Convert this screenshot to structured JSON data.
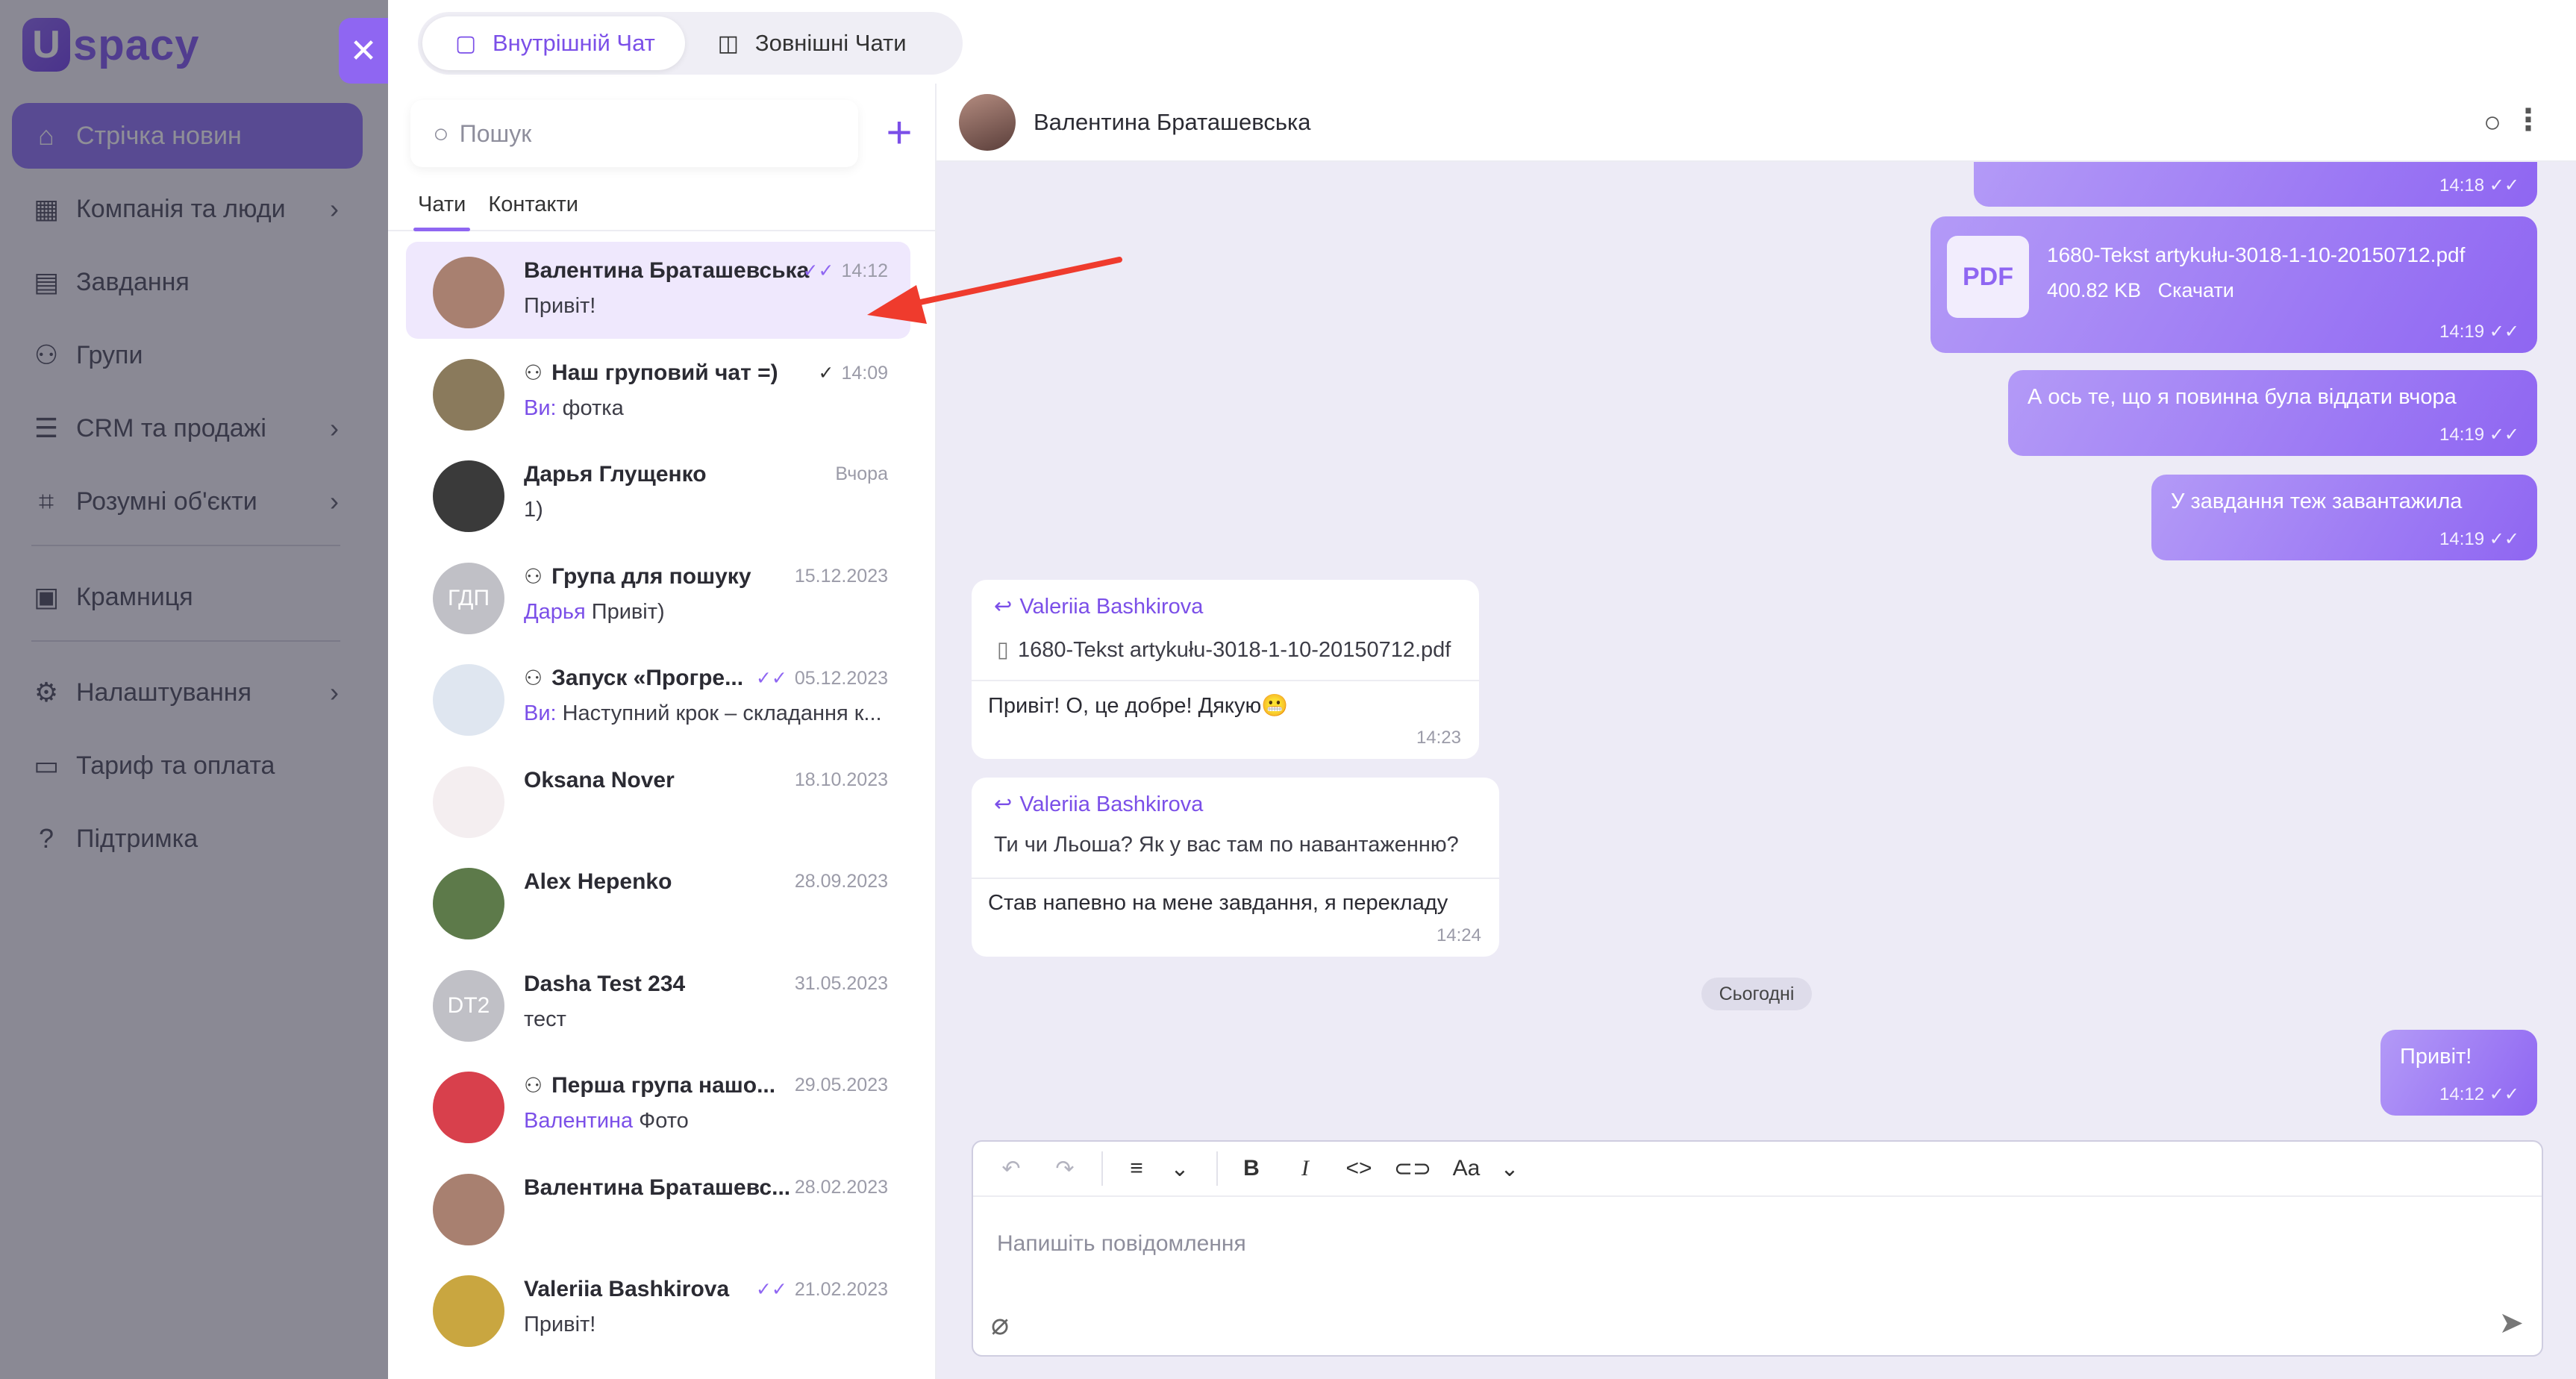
{
  "app": {
    "logo_letter": "U",
    "logo_text": "spacy",
    "close_label": "✕"
  },
  "nav": {
    "items": [
      {
        "label": "Стрічка новин",
        "icon": "home-icon",
        "glyph": "⌂"
      },
      {
        "label": "Компанія та люди",
        "icon": "building-icon",
        "glyph": "▦"
      },
      {
        "label": "Завдання",
        "icon": "calendar-icon",
        "glyph": "▤"
      },
      {
        "label": "Групи",
        "icon": "people-icon",
        "glyph": "⚇"
      },
      {
        "label": "CRM та продажі",
        "icon": "database-icon",
        "glyph": "☰"
      },
      {
        "label": "Розумні об'єкти",
        "icon": "scan-icon",
        "glyph": "⌗"
      },
      {
        "label": "Крамниця",
        "icon": "store-icon",
        "glyph": "▣"
      },
      {
        "label": "Налаштування",
        "icon": "gear-icon",
        "glyph": "⚙"
      },
      {
        "label": "Тариф та оплата",
        "icon": "wallet-icon",
        "glyph": "▭"
      },
      {
        "label": "Підтримка",
        "icon": "help-icon",
        "glyph": "?"
      }
    ],
    "chevron": "›"
  },
  "top_tabs": [
    {
      "label": "Внутрішній Чат",
      "icon": "chat-icon",
      "glyph": "▢"
    },
    {
      "label": "Зовнішні Чати",
      "icon": "chats-icon",
      "glyph": "◫"
    }
  ],
  "chat_panel": {
    "search_placeholder": "Пошук",
    "add_label": "+",
    "tabs": [
      "Чати",
      "Контакти"
    ]
  },
  "chats": [
    {
      "name": "Валентина Браташевська",
      "group": false,
      "time": "14:12",
      "tick": "✓✓",
      "sender": "",
      "message": "Привіт!",
      "avatar_text": "",
      "avatar_bg": "#a88070"
    },
    {
      "name": "Наш груповий чат =)",
      "group": true,
      "time": "14:09",
      "tick": "✓",
      "sender": "Ви:",
      "message": "фотка",
      "avatar_text": "",
      "avatar_bg": "#8a7a5c"
    },
    {
      "name": "Дарья Глущенко",
      "group": false,
      "time": "Вчора",
      "tick": "",
      "sender": "",
      "message": "1)",
      "avatar_text": "",
      "avatar_bg": "#3a3a3a"
    },
    {
      "name": "Група для пошуку",
      "group": true,
      "time": "15.12.2023",
      "tick": "",
      "sender": "Дарья",
      "message": "Привіт)",
      "avatar_text": "ГДП",
      "avatar_bg": "#c0c0c6"
    },
    {
      "name": "Запуск «Прогре...",
      "group": true,
      "time": "05.12.2023",
      "tick": "✓✓",
      "sender": "Ви:",
      "message": "Наступний крок – складання к...",
      "avatar_text": "",
      "avatar_bg": "#dfe6f0"
    },
    {
      "name": "Oksana Nover",
      "group": false,
      "time": "18.10.2023",
      "tick": "",
      "sender": "",
      "message": "",
      "avatar_text": "",
      "avatar_bg": "#f4eef0"
    },
    {
      "name": "Alex Hepenko",
      "group": false,
      "time": "28.09.2023",
      "tick": "",
      "sender": "",
      "message": "",
      "avatar_text": "",
      "avatar_bg": "#5d7a4a"
    },
    {
      "name": "Dasha Test 234",
      "group": false,
      "time": "31.05.2023",
      "tick": "",
      "sender": "",
      "message": "тест",
      "avatar_text": "DT2",
      "avatar_bg": "#c0c0c6"
    },
    {
      "name": "Перша група нашо...",
      "group": true,
      "time": "29.05.2023",
      "tick": "",
      "sender": "Валентина",
      "message": "Фото",
      "avatar_text": "",
      "avatar_bg": "#d8404c"
    },
    {
      "name": "Валентина Браташевс...",
      "group": false,
      "time": "28.02.2023",
      "tick": "",
      "sender": "",
      "message": "",
      "avatar_text": "",
      "avatar_bg": "#a88070"
    },
    {
      "name": "Valeriia Bashkirova",
      "group": false,
      "time": "21.02.2023",
      "tick": "✓✓",
      "sender": "",
      "message": "Привіт!",
      "avatar_text": "",
      "avatar_bg": "#c9a640"
    }
  ],
  "conversation": {
    "title": "Валентина Браташевська",
    "search_glyph": "○",
    "more_glyph": "⋮",
    "msg_top_time": "14:18",
    "pdf": {
      "badge": "PDF",
      "filename": "1680-Tekst artykułu-3018-1-10-20150712.pdf",
      "size": "400.82 KB",
      "download": "Скачати",
      "time": "14:19"
    },
    "out1": {
      "text": "А ось те, що я повинна була віддати вчора",
      "time": "14:19"
    },
    "out2": {
      "text": "У завдання теж завантажила",
      "time": "14:19"
    },
    "in1": {
      "reply_name": "Valeriia Bashkirova",
      "reply_file": "1680-Tekst artykułu-3018-1-10-20150712.pdf",
      "text": "Привіт! О, це добре! Дякую",
      "emoji": "😬",
      "time": "14:23"
    },
    "in2": {
      "reply_name": "Valeriia Bashkirova",
      "reply_text": "Ти чи Льоша? Як у вас там по навантаженню?",
      "text": "Став напевно на мене завдання, я перекладу",
      "time": "14:24"
    },
    "day_label": "Сьогодні",
    "out3": {
      "text": "Привіт!",
      "time": "14:12"
    },
    "read_tick": "✓✓"
  },
  "composer": {
    "placeholder": "Напишіть повідомлення",
    "toolbar": [
      "↶",
      "↷",
      "≡",
      "⌄",
      "B",
      "I",
      "<>",
      "⊂⊃",
      "Aa",
      "⌄"
    ],
    "attach_glyph": "⌀",
    "send_glyph": "➤"
  },
  "colors": {
    "accent": "#8f66f2",
    "annotation_arrow": "#ef3b2d"
  }
}
